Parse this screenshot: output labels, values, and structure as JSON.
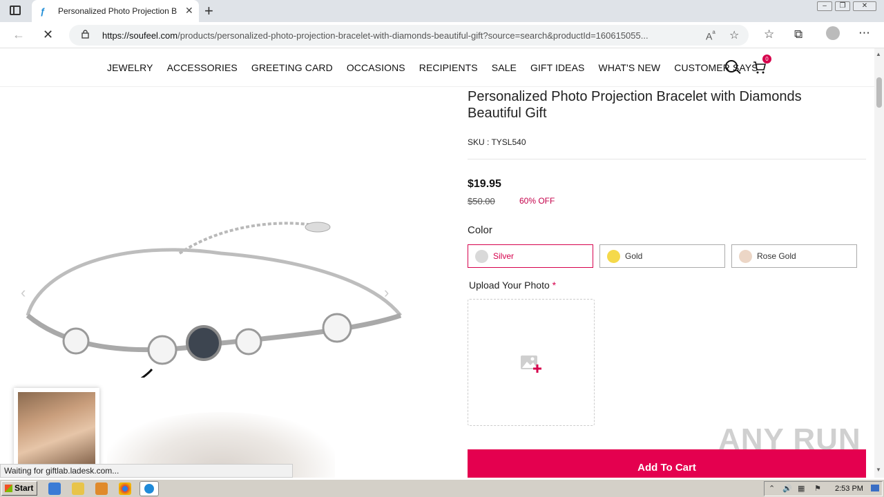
{
  "browser": {
    "tab_title": "Personalized Photo Projection Br",
    "url_host": "https://soufeel.com",
    "url_path": "/products/personalized-photo-projection-bracelet-with-diamonds-beautiful-gift?source=search&productId=160615055...",
    "status_text": "Waiting for giftlab.ladesk.com..."
  },
  "site": {
    "menu": [
      "JEWELRY",
      "ACCESSORIES",
      "GREETING CARD",
      "OCCASIONS",
      "RECIPIENTS",
      "SALE",
      "GIFT IDEAS",
      "WHAT'S NEW",
      "CUSTOMER SAYS"
    ],
    "cart_count": "0"
  },
  "product": {
    "name": "Personalized Photo Projection Bracelet with Diamonds Beautiful Gift",
    "sku": "SKU : TYSL540",
    "price": "$19.95",
    "old_price": "$50.00",
    "discount": "60% OFF",
    "color_label": "Color",
    "colors": [
      {
        "label": "Silver",
        "swatch": "#d9d9d9",
        "selected": true
      },
      {
        "label": "Gold",
        "swatch": "#f5d94a",
        "selected": false
      },
      {
        "label": "Rose Gold",
        "swatch": "#ecd6c6",
        "selected": false
      }
    ],
    "upload_label": "Upload Your Photo",
    "required_mark": "*",
    "add_to_cart": "Add To Cart"
  },
  "watermark": "ANY RUN",
  "taskbar": {
    "start_label": "Start",
    "clock": "2:53 PM"
  },
  "colors": {
    "accent": "#e4004f",
    "selected_border": "#d6004c"
  }
}
